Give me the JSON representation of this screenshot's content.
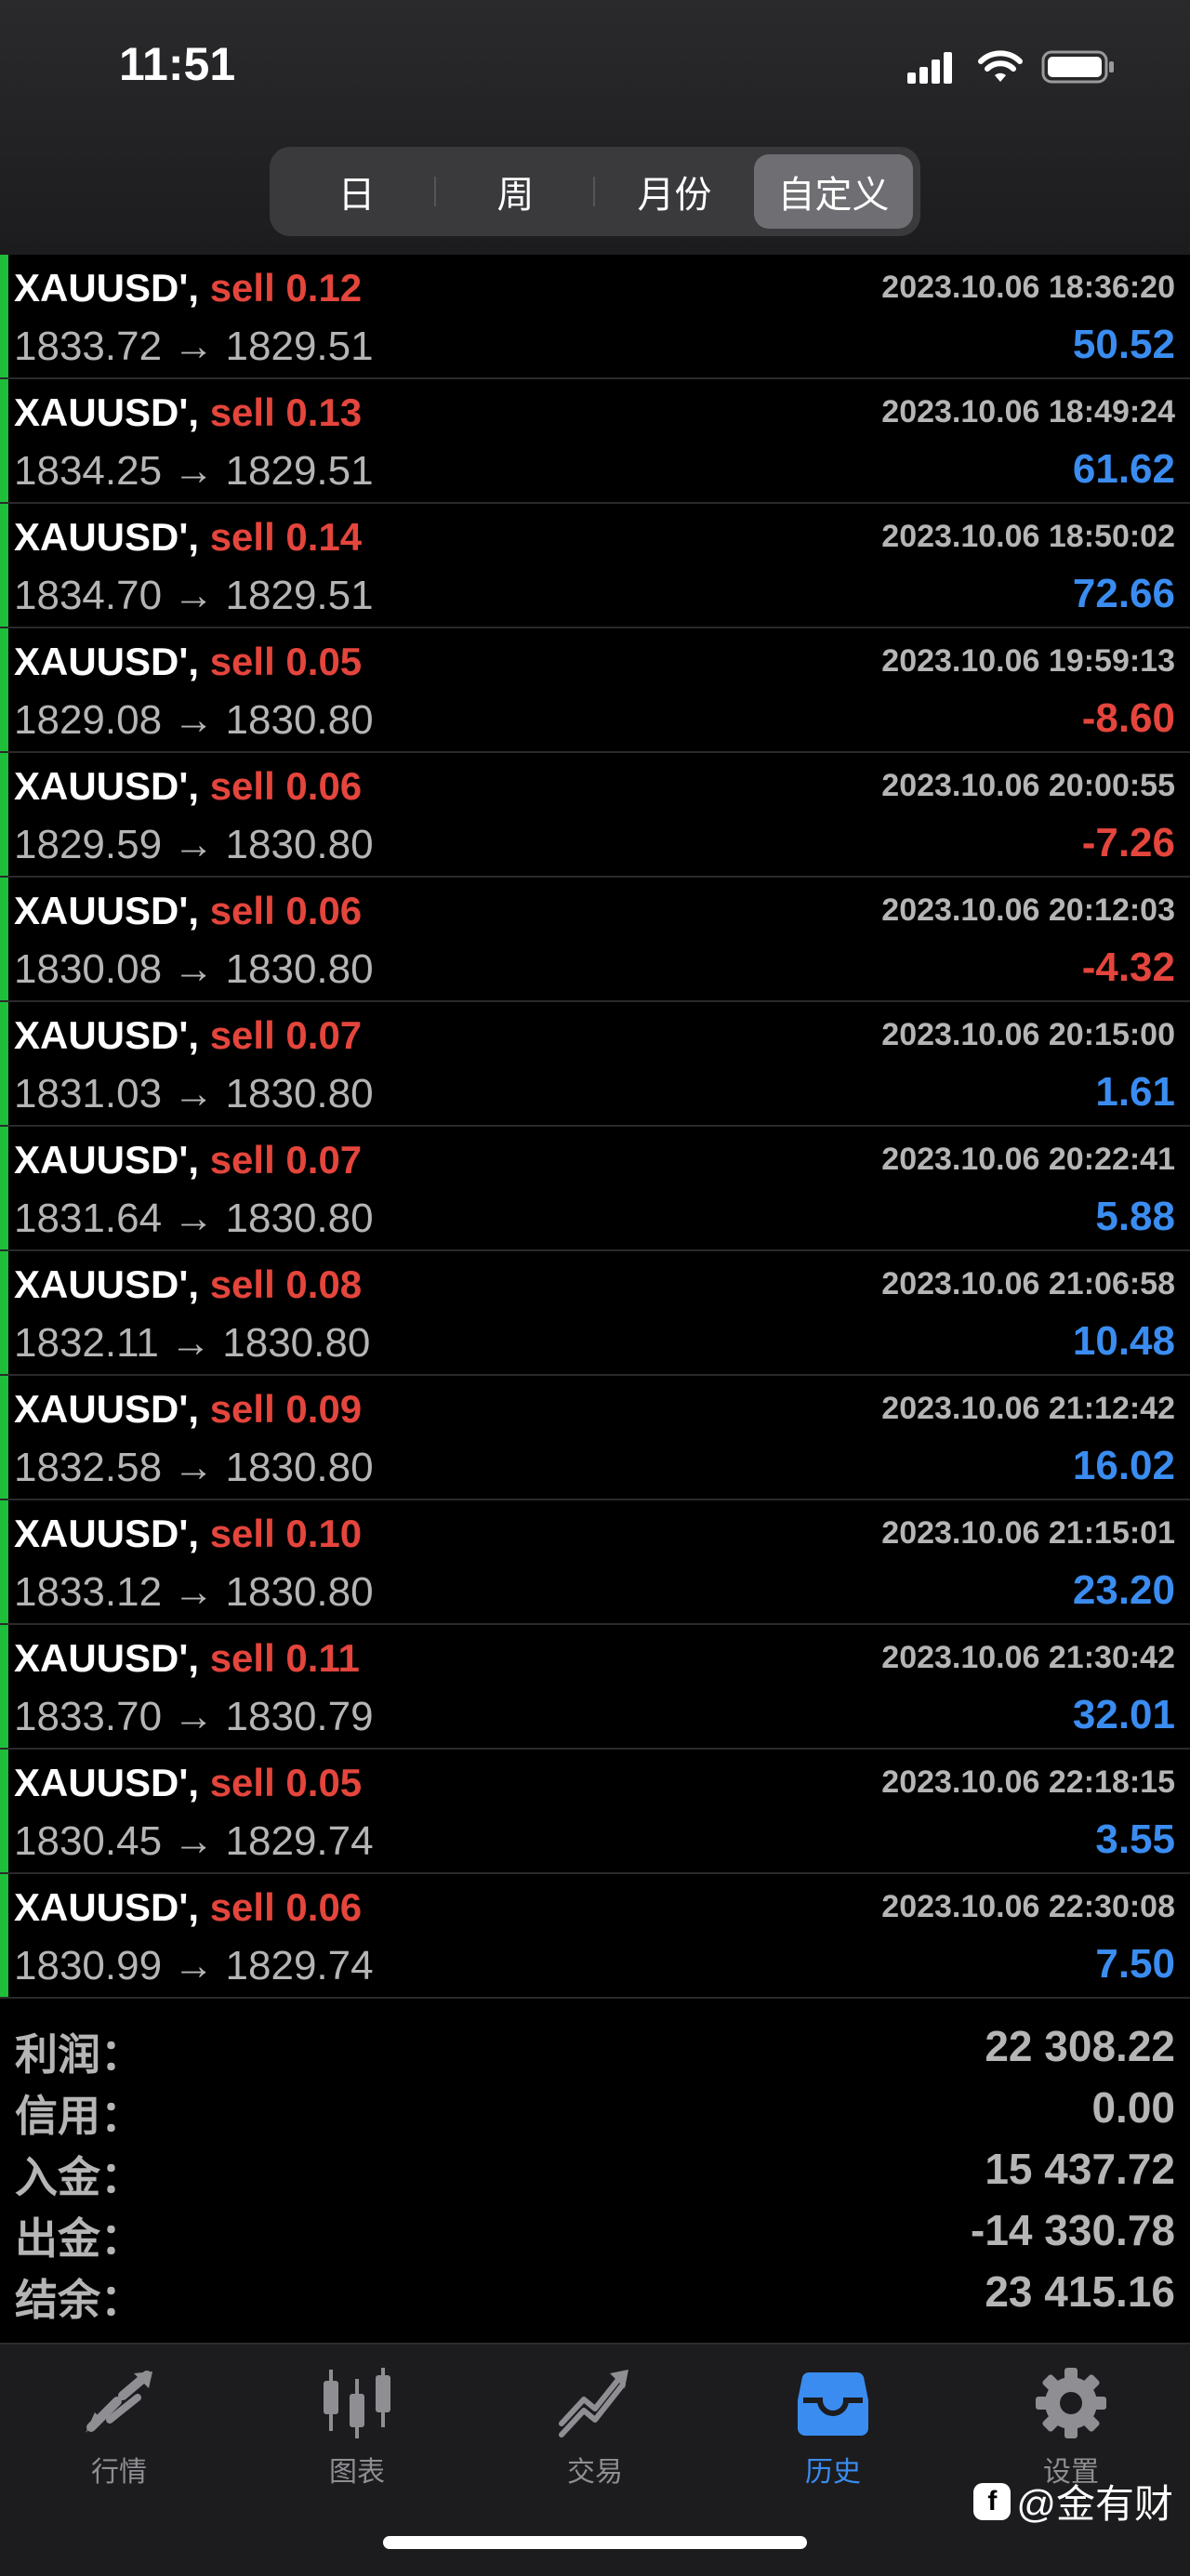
{
  "status_bar": {
    "time": "11:51"
  },
  "segments": [
    {
      "label": "日",
      "active": false
    },
    {
      "label": "周",
      "active": false
    },
    {
      "label": "月份",
      "active": false
    },
    {
      "label": "自定义",
      "active": true
    }
  ],
  "trades": [
    {
      "symbol": "XAUUSD'",
      "sep": ",",
      "side": "sell",
      "volume": "0.12",
      "time": "2023.10.06 18:36:20",
      "open": "1833.72",
      "arrow": "→",
      "close": "1829.51",
      "profit": "50.52",
      "positive": true
    },
    {
      "symbol": "XAUUSD'",
      "sep": ",",
      "side": "sell",
      "volume": "0.13",
      "time": "2023.10.06 18:49:24",
      "open": "1834.25",
      "arrow": "→",
      "close": "1829.51",
      "profit": "61.62",
      "positive": true
    },
    {
      "symbol": "XAUUSD'",
      "sep": ",",
      "side": "sell",
      "volume": "0.14",
      "time": "2023.10.06 18:50:02",
      "open": "1834.70",
      "arrow": "→",
      "close": "1829.51",
      "profit": "72.66",
      "positive": true
    },
    {
      "symbol": "XAUUSD'",
      "sep": ",",
      "side": "sell",
      "volume": "0.05",
      "time": "2023.10.06 19:59:13",
      "open": "1829.08",
      "arrow": "→",
      "close": "1830.80",
      "profit": "-8.60",
      "positive": false
    },
    {
      "symbol": "XAUUSD'",
      "sep": ",",
      "side": "sell",
      "volume": "0.06",
      "time": "2023.10.06 20:00:55",
      "open": "1829.59",
      "arrow": "→",
      "close": "1830.80",
      "profit": "-7.26",
      "positive": false
    },
    {
      "symbol": "XAUUSD'",
      "sep": ",",
      "side": "sell",
      "volume": "0.06",
      "time": "2023.10.06 20:12:03",
      "open": "1830.08",
      "arrow": "→",
      "close": "1830.80",
      "profit": "-4.32",
      "positive": false
    },
    {
      "symbol": "XAUUSD'",
      "sep": ",",
      "side": "sell",
      "volume": "0.07",
      "time": "2023.10.06 20:15:00",
      "open": "1831.03",
      "arrow": "→",
      "close": "1830.80",
      "profit": "1.61",
      "positive": true
    },
    {
      "symbol": "XAUUSD'",
      "sep": ",",
      "side": "sell",
      "volume": "0.07",
      "time": "2023.10.06 20:22:41",
      "open": "1831.64",
      "arrow": "→",
      "close": "1830.80",
      "profit": "5.88",
      "positive": true
    },
    {
      "symbol": "XAUUSD'",
      "sep": ",",
      "side": "sell",
      "volume": "0.08",
      "time": "2023.10.06 21:06:58",
      "open": "1832.11",
      "arrow": "→",
      "close": "1830.80",
      "profit": "10.48",
      "positive": true
    },
    {
      "symbol": "XAUUSD'",
      "sep": ",",
      "side": "sell",
      "volume": "0.09",
      "time": "2023.10.06 21:12:42",
      "open": "1832.58",
      "arrow": "→",
      "close": "1830.80",
      "profit": "16.02",
      "positive": true
    },
    {
      "symbol": "XAUUSD'",
      "sep": ",",
      "side": "sell",
      "volume": "0.10",
      "time": "2023.10.06 21:15:01",
      "open": "1833.12",
      "arrow": "→",
      "close": "1830.80",
      "profit": "23.20",
      "positive": true
    },
    {
      "symbol": "XAUUSD'",
      "sep": ",",
      "side": "sell",
      "volume": "0.11",
      "time": "2023.10.06 21:30:42",
      "open": "1833.70",
      "arrow": "→",
      "close": "1830.79",
      "profit": "32.01",
      "positive": true
    },
    {
      "symbol": "XAUUSD'",
      "sep": ",",
      "side": "sell",
      "volume": "0.05",
      "time": "2023.10.06 22:18:15",
      "open": "1830.45",
      "arrow": "→",
      "close": "1829.74",
      "profit": "3.55",
      "positive": true
    },
    {
      "symbol": "XAUUSD'",
      "sep": ",",
      "side": "sell",
      "volume": "0.06",
      "time": "2023.10.06 22:30:08",
      "open": "1830.99",
      "arrow": "→",
      "close": "1829.74",
      "profit": "7.50",
      "positive": true
    }
  ],
  "summary": [
    {
      "label": "利润：",
      "value": "22 308.22"
    },
    {
      "label": "信用：",
      "value": "0.00"
    },
    {
      "label": "入金：",
      "value": "15 437.72"
    },
    {
      "label": "出金：",
      "value": "-14 330.78"
    },
    {
      "label": "结余：",
      "value": "23 415.16"
    }
  ],
  "tabs": [
    {
      "label": "行情",
      "icon": "quotes-arrows-icon",
      "active": false
    },
    {
      "label": "图表",
      "icon": "candlestick-chart-icon",
      "active": false
    },
    {
      "label": "交易",
      "icon": "trade-chart-icon",
      "active": false
    },
    {
      "label": "历史",
      "icon": "history-inbox-icon",
      "active": true
    },
    {
      "label": "设置",
      "icon": "gear-icon",
      "active": false
    }
  ],
  "watermark": {
    "logo": "f",
    "text": "@金有财"
  },
  "colors": {
    "profit_positive": "#3a8cf0",
    "profit_negative": "#e4453c",
    "sell": "#e4453c",
    "row_bar": "#1fbe3a",
    "active_tab": "#3a8cf0"
  }
}
